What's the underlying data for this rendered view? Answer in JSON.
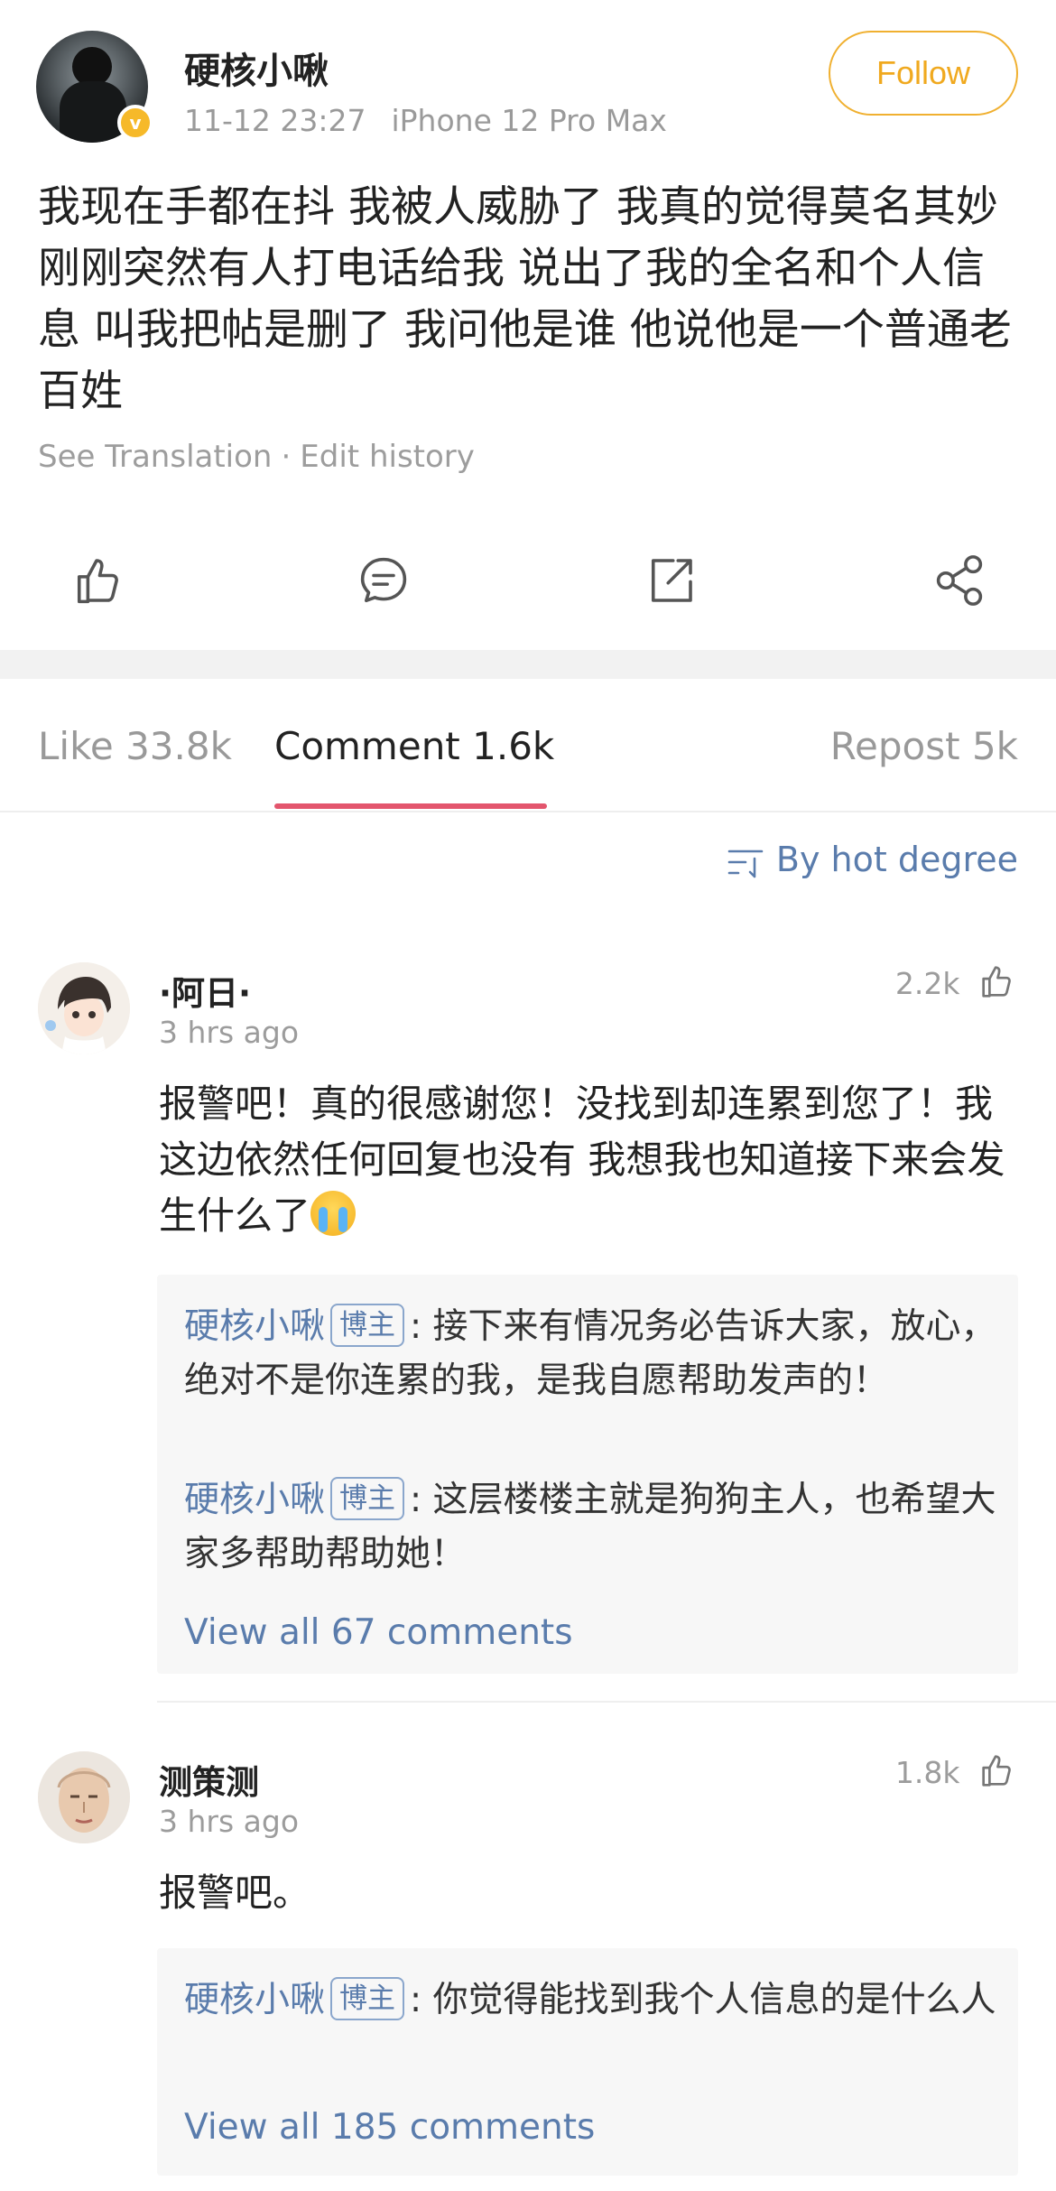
{
  "post": {
    "author": "硬核小啾",
    "time": "11-12 23:27",
    "device": "iPhone 12 Pro Max",
    "follow_label": "Follow",
    "text": "我现在手都在抖 我被人威胁了 我真的觉得莫名其妙 刚刚突然有人打电话给我 说出了我的全名和个人信息 叫我把帖是删了 我问他是谁 他说他是一个普通老百姓",
    "see_translation": "See Translation",
    "separator": "·",
    "edit_history": "Edit history"
  },
  "actions": [
    "like-icon",
    "comment-icon",
    "repost-icon",
    "share-icon"
  ],
  "tabs": {
    "like": "Like 33.8k",
    "comment": "Comment 1.6k",
    "repost": "Repost 5k"
  },
  "sort_label": "By hot degree",
  "comments": [
    {
      "name": "·阿日·",
      "time": "3 hrs ago",
      "likes": "2.2k",
      "text": "报警吧！真的很感谢您！没找到却连累到您了！我这边依然任何回复也没有 我想我也知道接下来会发生什么了",
      "replies": [
        {
          "author": "硬核小啾",
          "badge": "博主",
          "text": ": 接下来有情况务必告诉大家，放心，绝对不是你连累的我，是我自愿帮助发声的！"
        },
        {
          "author": "硬核小啾",
          "badge": "博主",
          "text": ": 这层楼楼主就是狗狗主人，也希望大家多帮助帮助她！"
        }
      ],
      "view_all": "View all 67 comments"
    },
    {
      "name": "测策测",
      "time": "3 hrs ago",
      "likes": "1.8k",
      "text": "报警吧。",
      "replies": [
        {
          "author": "硬核小啾",
          "badge": "博主",
          "text": ": 你觉得能找到我个人信息的是什么人"
        }
      ],
      "view_all": "View all 185 comments"
    }
  ],
  "colors": {
    "accent_follow": "#f0a91f",
    "link_blue": "#5a7cac",
    "tab_underline": "#e3556d"
  }
}
